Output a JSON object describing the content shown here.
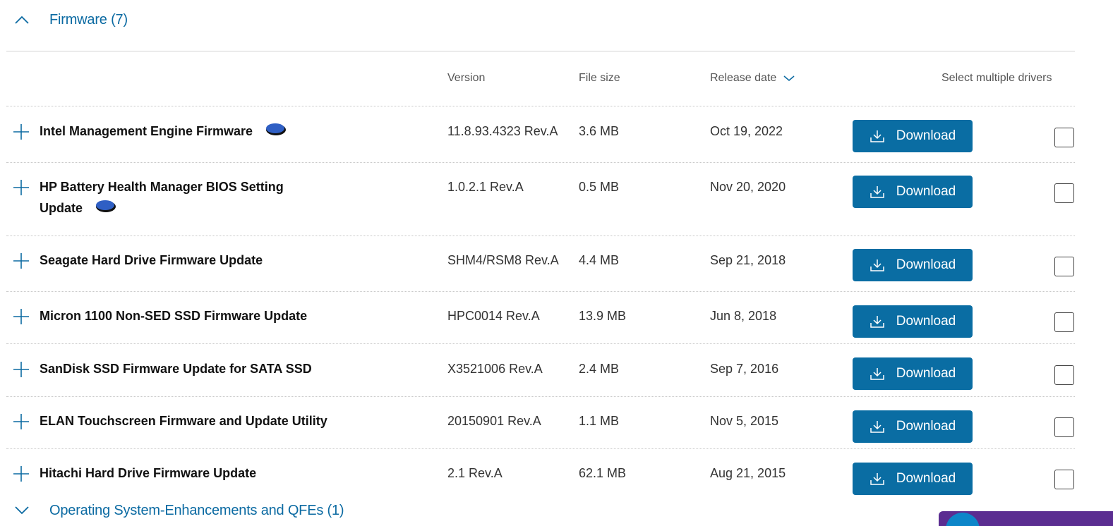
{
  "sections": {
    "firmware_title": "Firmware (7)",
    "os_title": "Operating System-Enhancements and QFEs (1)"
  },
  "columns": {
    "version": "Version",
    "file_size": "File size",
    "release_date": "Release date",
    "select_multiple": "Select multiple drivers"
  },
  "rows": [
    {
      "name": "Intel Management Engine Firmware",
      "version": "11.8.93.4323 Rev.A",
      "size": "3.6 MB",
      "date": "Oct 19, 2022",
      "download": "Download",
      "badge": true
    },
    {
      "name": "HP Battery Health Manager BIOS Setting",
      "name2": "Update",
      "version": "1.0.2.1 Rev.A",
      "size": "0.5 MB",
      "date": "Nov 20, 2020",
      "download": "Download",
      "badge": true
    },
    {
      "name": "Seagate Hard Drive Firmware Update",
      "version": "SHM4/RSM8 Rev.A",
      "size": "4.4 MB",
      "date": "Sep 21, 2018",
      "download": "Download"
    },
    {
      "name": "Micron 1100 Non-SED SSD Firmware Update",
      "version": "HPC0014 Rev.A",
      "size": "13.9 MB",
      "date": "Jun 8, 2018",
      "download": "Download"
    },
    {
      "name": "SanDisk SSD Firmware Update for SATA SSD",
      "version": "X3521006 Rev.A",
      "size": "2.4 MB",
      "date": "Sep 7, 2016",
      "download": "Download"
    },
    {
      "name": "ELAN Touchscreen Firmware and Update Utility",
      "version": "20150901 Rev.A",
      "size": "1.1 MB",
      "date": "Nov 5, 2015",
      "download": "Download"
    },
    {
      "name": "Hitachi Hard Drive Firmware Update",
      "version": "2.1 Rev.A",
      "size": "62.1 MB",
      "date": "Aug 21, 2015",
      "download": "Download"
    }
  ],
  "icons": {
    "collapse": "chevron-up-icon",
    "expand": "chevron-down-icon",
    "row_expand": "plus-icon",
    "download": "download-icon",
    "badge": "blue-oval-badge-icon"
  },
  "colors": {
    "accent": "#0a6da3",
    "link": "#0b6aa2",
    "badge": "#2f5fc4"
  }
}
